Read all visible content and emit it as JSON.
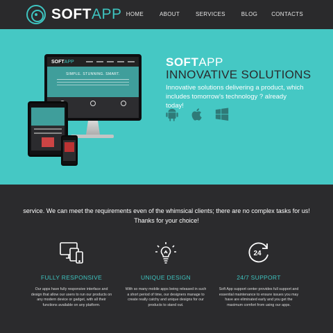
{
  "brand": {
    "bold": "SOFT",
    "light": "APP"
  },
  "nav": [
    "HOME",
    "ABOUT",
    "SERVICES",
    "BLOG",
    "CONTACTS"
  ],
  "hero": {
    "title_bold": "SOFT",
    "title_light": "APP",
    "subtitle": "INNOVATIVE SOLUTIONS",
    "description": "Innovative solutions delivering a product, which includes tomorrow's technology ? already today!",
    "platforms": [
      "android-icon",
      "apple-icon",
      "windows-icon"
    ],
    "mockup": {
      "screen_title": "SIMPLE. STUNNING. SMART."
    }
  },
  "intro": "service. We can meet the requirements even of the whimsical clients; there are no complex tasks for us! Thanks for your choice!",
  "features": [
    {
      "icon": "responsive-devices-icon",
      "title": "FULLY RESPONSIVE",
      "text": "Our apps have fully responsive interface and design that allow our users to run our products on any modern device or gadget, with all their functions available on any platform."
    },
    {
      "icon": "lightbulb-icon",
      "title": "UNIQUE DESIGN",
      "text": "With so many mobile apps being released in such a short period of time, our designers manage to create really catchy and unique designs for our products to stand out."
    },
    {
      "icon": "support-24-icon",
      "title": "24/7 SUPPORT",
      "text": "Soft App support center provides full support and essential maintenance to ensure issues you may have are eliminated early and you get the maximum comfort from using our apps."
    }
  ],
  "colors": {
    "accent": "#45c8c4",
    "dark": "#2b2b2d",
    "header": "#2a2a2c"
  }
}
